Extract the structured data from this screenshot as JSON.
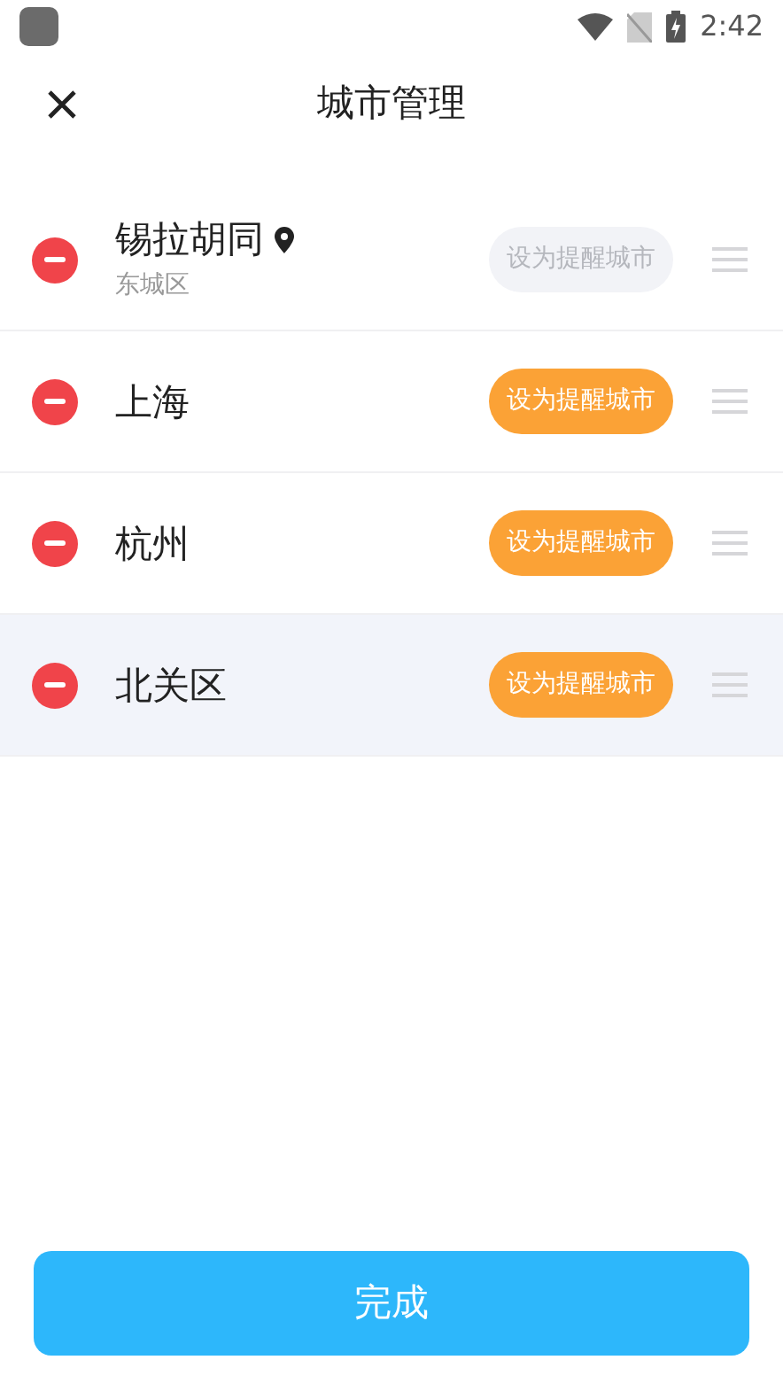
{
  "status_bar": {
    "time": "2:42"
  },
  "header": {
    "title": "城市管理"
  },
  "cities": [
    {
      "name": "锡拉胡同",
      "located": true,
      "district": "东城区",
      "reminder_button": "设为提醒城市",
      "disabled": true,
      "highlighted": false
    },
    {
      "name": "上海",
      "located": false,
      "reminder_button": "设为提醒城市",
      "disabled": false,
      "highlighted": false
    },
    {
      "name": "杭州",
      "located": false,
      "reminder_button": "设为提醒城市",
      "disabled": false,
      "highlighted": false
    },
    {
      "name": "北关区",
      "located": false,
      "reminder_button": "设为提醒城市",
      "disabled": false,
      "highlighted": true
    }
  ],
  "done_button": "完成"
}
